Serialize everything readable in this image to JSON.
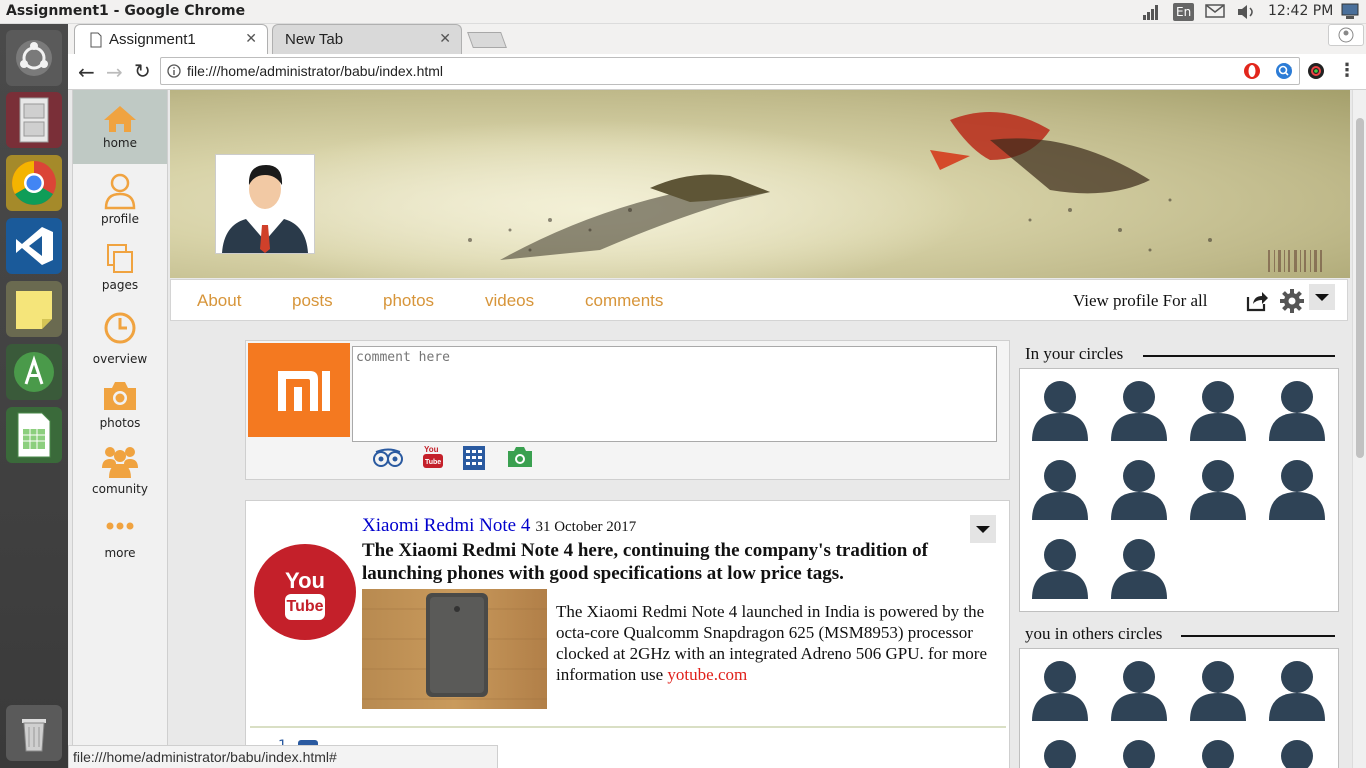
{
  "window": {
    "title": "Assignment1 - Google Chrome"
  },
  "system_tray": {
    "keyboard_layout": "En",
    "clock": "12:42 PM"
  },
  "browser": {
    "tabs": [
      {
        "label": "Assignment1",
        "active": true
      },
      {
        "label": "New Tab",
        "active": false
      }
    ],
    "url": "file:///home/administrator/babu/index.html",
    "status_url": "file:///home/administrator/babu/index.html#"
  },
  "sidebar": {
    "items": [
      {
        "label": "home",
        "icon": "home-icon",
        "active": true
      },
      {
        "label": "profile",
        "icon": "user-icon"
      },
      {
        "label": "pages",
        "icon": "pages-icon"
      },
      {
        "label": "overview",
        "icon": "clock-icon"
      },
      {
        "label": "photos",
        "icon": "camera-icon"
      },
      {
        "label": "comunity",
        "icon": "group-icon"
      },
      {
        "label": "more",
        "icon": "more-icon"
      }
    ]
  },
  "profile_tabs": {
    "items": [
      "About",
      "posts",
      "photos",
      "videos",
      "comments"
    ],
    "view_profile": "View profile For all"
  },
  "composer": {
    "placeholder": "comment here",
    "brand_icon": "mi-logo",
    "actions": [
      "tripadvisor-icon",
      "youtube-icon",
      "calculator-icon",
      "camera-icon"
    ]
  },
  "post": {
    "title": "Xiaomi Redmi Note 4",
    "date": "31 October 2017",
    "headline": "The Xiaomi Redmi Note 4 here, continuing the company's tradition of launching phones with good specifications at low price tags.",
    "body": "The Xiaomi Redmi Note 4 launched in India is powered by the octa-core Qualcomm Snapdragon 625 (MSM8953) processor clocked at 2GHz with an integrated Adreno 506 GPU. for more information use",
    "link": "yotube.com",
    "youtube_label_top": "You",
    "youtube_label_bottom": "Tube",
    "footer_count": "1"
  },
  "circles": {
    "in_your_circles": "In your circles",
    "you_in_others": "you in others circles"
  },
  "colors": {
    "accent": "#d7953a",
    "link_blue": "#0000cc",
    "link_red": "#e0201a",
    "person_fill": "#2f4356",
    "mi_orange": "#f47920",
    "youtube_red": "#c4202a"
  }
}
